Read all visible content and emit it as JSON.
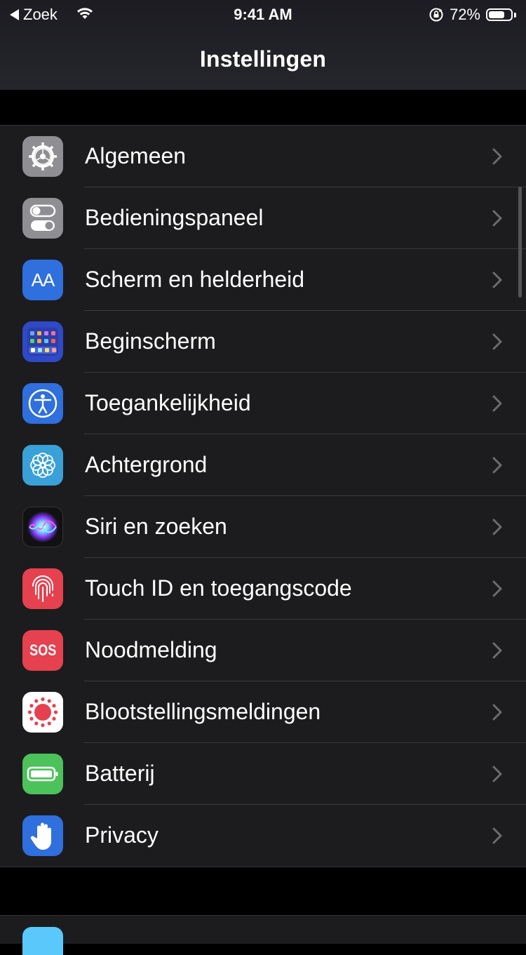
{
  "status_bar": {
    "back_label": "Zoek",
    "time": "9:41 AM",
    "battery_percent": "72%",
    "battery_level": 0.72
  },
  "nav": {
    "title": "Instellingen"
  },
  "rows": [
    {
      "label": "Algemeen",
      "icon": "gear-icon",
      "color": "#8e8e93"
    },
    {
      "label": "Bedieningspaneel",
      "icon": "toggles-icon",
      "color": "#8e8e93"
    },
    {
      "label": "Scherm en helderheid",
      "icon": "text-size-icon",
      "icon_text": "AA",
      "color": "#2f6fde"
    },
    {
      "label": "Beginscherm",
      "icon": "home-screen-icon",
      "color": "#2f49c8"
    },
    {
      "label": "Toegankelijkheid",
      "icon": "accessibility-icon",
      "color": "#2f6fde"
    },
    {
      "label": "Achtergrond",
      "icon": "wallpaper-flower-icon",
      "color": "#3aa0d8"
    },
    {
      "label": "Siri en zoeken",
      "icon": "siri-icon",
      "color": "#111"
    },
    {
      "label": "Touch ID en toegangscode",
      "icon": "fingerprint-icon",
      "color": "#e5414f"
    },
    {
      "label": "Noodmelding",
      "icon": "sos-icon",
      "icon_text": "SOS",
      "color": "#e5414f"
    },
    {
      "label": "Blootstellingsmeldingen",
      "icon": "exposure-icon",
      "color": "#ffffff"
    },
    {
      "label": "Batterij",
      "icon": "battery-icon",
      "color": "#4cc25a"
    },
    {
      "label": "Privacy",
      "icon": "hand-icon",
      "color": "#2f6fde"
    }
  ]
}
